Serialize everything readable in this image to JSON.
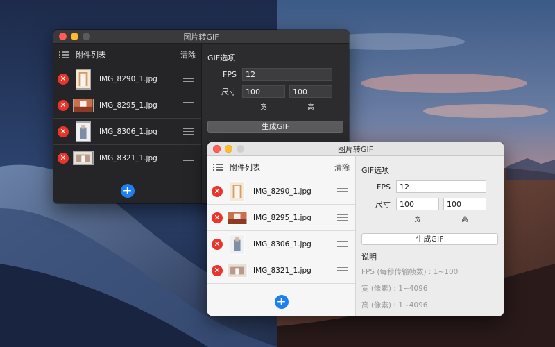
{
  "windows": {
    "dark": {
      "title": "图片转GIF",
      "list_title": "附件列表",
      "clear_label": "清除",
      "files": [
        {
          "name": "IMG_8290_1.jpg"
        },
        {
          "name": "IMG_8295_1.jpg"
        },
        {
          "name": "IMG_8306_1.jpg"
        },
        {
          "name": "IMG_8321_1.jpg"
        }
      ],
      "options": {
        "title": "GIF选项",
        "fps_label": "FPS",
        "fps_value": "12",
        "size_label": "尺寸",
        "width_value": "100",
        "height_value": "100",
        "width_label": "宽",
        "height_label": "高",
        "generate_label": "生成GIF"
      }
    },
    "light": {
      "title": "图片转GIF",
      "list_title": "附件列表",
      "clear_label": "清除",
      "files": [
        {
          "name": "IMG_8290_1.jpg"
        },
        {
          "name": "IMG_8295_1.jpg"
        },
        {
          "name": "IMG_8306_1.jpg"
        },
        {
          "name": "IMG_8321_1.jpg"
        }
      ],
      "options": {
        "title": "GIF选项",
        "fps_label": "FPS",
        "fps_value": "12",
        "size_label": "尺寸",
        "width_value": "100",
        "height_value": "100",
        "width_label": "宽",
        "height_label": "高",
        "generate_label": "生成GIF"
      },
      "description": {
        "title": "说明",
        "lines": [
          "FPS (每秒传输帧数) : 1~100",
          "宽 (像素) : 1~4096",
          "高 (像素) : 1~4096"
        ]
      }
    }
  },
  "colors": {
    "accent": "#1e7ff0",
    "delete": "#e8352b",
    "close": "#fe5f57",
    "minimize": "#febc2e"
  },
  "icons": {
    "list": "list-icon",
    "delete": "remove-circle-icon",
    "drag": "drag-handle-icon",
    "add": "plus-circle-icon"
  }
}
